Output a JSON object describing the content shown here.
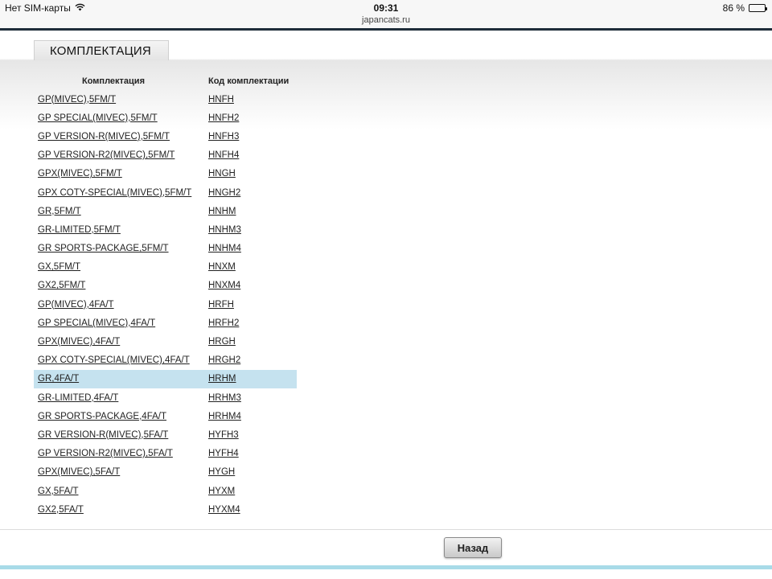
{
  "status_bar": {
    "carrier": "Нет SIM-карты",
    "time": "09:31",
    "url": "japancats.ru",
    "battery_text": "86 %",
    "battery_level": 0.86
  },
  "tab": {
    "label": "КОМПЛЕКТАЦИЯ"
  },
  "table": {
    "headers": [
      "Комплектация",
      "Код комплектации"
    ],
    "selected_row": 15,
    "rows": [
      {
        "name": "GP(MIVEC),5FM/T",
        "code": "HNFH"
      },
      {
        "name": "GP SPECIAL(MIVEC),5FM/T",
        "code": "HNFH2"
      },
      {
        "name": "GP VERSION-R(MIVEC),5FM/T",
        "code": "HNFH3"
      },
      {
        "name": "GP VERSION-R2(MIVEC),5FM/T",
        "code": "HNFH4"
      },
      {
        "name": "GPX(MIVEC),5FM/T",
        "code": "HNGH"
      },
      {
        "name": "GPX COTY-SPECIAL(MIVEC),5FM/T",
        "code": "HNGH2"
      },
      {
        "name": "GR,5FM/T",
        "code": "HNHM"
      },
      {
        "name": "GR-LIMITED,5FM/T",
        "code": "HNHM3"
      },
      {
        "name": "GR SPORTS-PACKAGE,5FM/T",
        "code": "HNHM4"
      },
      {
        "name": "GX,5FM/T",
        "code": "HNXM"
      },
      {
        "name": "GX2,5FM/T",
        "code": "HNXM4"
      },
      {
        "name": "GP(MIVEC),4FA/T",
        "code": "HRFH"
      },
      {
        "name": "GP SPECIAL(MIVEC),4FA/T",
        "code": "HRFH2"
      },
      {
        "name": "GPX(MIVEC),4FA/T",
        "code": "HRGH"
      },
      {
        "name": "GPX COTY-SPECIAL(MIVEC),4FA/T",
        "code": "HRGH2"
      },
      {
        "name": "GR,4FA/T",
        "code": "HRHM"
      },
      {
        "name": "GR-LIMITED,4FA/T",
        "code": "HRHM3"
      },
      {
        "name": "GR SPORTS-PACKAGE,4FA/T",
        "code": "HRHM4"
      },
      {
        "name": "GR VERSION-R(MIVEC),5FA/T",
        "code": "HYFH3"
      },
      {
        "name": "GP VERSION-R2(MIVEC),5FA/T",
        "code": "HYFH4"
      },
      {
        "name": "GPX(MIVEC),5FA/T",
        "code": "HYGH"
      },
      {
        "name": "GX,5FA/T",
        "code": "HYXM"
      },
      {
        "name": "GX2,5FA/T",
        "code": "HYXM4"
      }
    ]
  },
  "back_button": {
    "label": "Назад"
  },
  "colors": {
    "selected_row": "#c5e2ef",
    "header_rule": "#1f2d3a",
    "bottom_bar": "#a8dbe8"
  }
}
